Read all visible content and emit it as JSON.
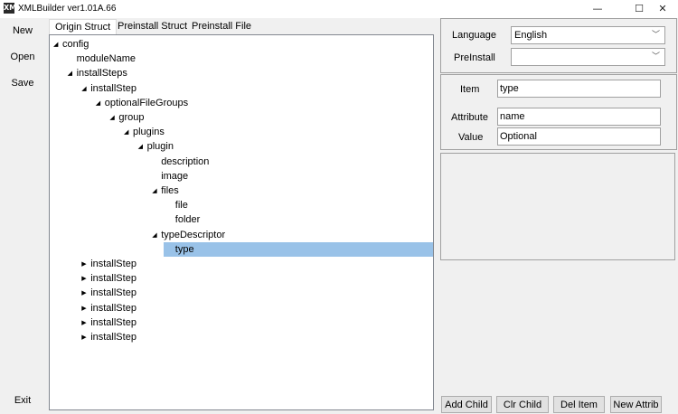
{
  "window": {
    "title": "XMLBuilder ver1.01A.66",
    "icon": "XML"
  },
  "window_controls": {
    "minimize": "—",
    "maximize": "☐",
    "close": "✕"
  },
  "toolbar": {
    "new": "New",
    "open": "Open",
    "save": "Save",
    "exit": "Exit"
  },
  "tabs": [
    "Origin Struct",
    "Preinstall Struct",
    "Preinstall File"
  ],
  "tree": {
    "expanded_glyph": "◢",
    "collapsed_glyph": "▶",
    "nodes": [
      {
        "label": "config",
        "depth": 0,
        "toggle": "expanded"
      },
      {
        "label": "moduleName",
        "depth": 1,
        "toggle": "none"
      },
      {
        "label": "installSteps",
        "depth": 1,
        "toggle": "expanded"
      },
      {
        "label": "installStep",
        "depth": 2,
        "toggle": "expanded"
      },
      {
        "label": "optionalFileGroups",
        "depth": 3,
        "toggle": "expanded"
      },
      {
        "label": "group",
        "depth": 4,
        "toggle": "expanded"
      },
      {
        "label": "plugins",
        "depth": 5,
        "toggle": "expanded"
      },
      {
        "label": "plugin",
        "depth": 6,
        "toggle": "expanded"
      },
      {
        "label": "description",
        "depth": 7,
        "toggle": "none"
      },
      {
        "label": "image",
        "depth": 7,
        "toggle": "none"
      },
      {
        "label": "files",
        "depth": 7,
        "toggle": "expanded"
      },
      {
        "label": "file",
        "depth": 8,
        "toggle": "none"
      },
      {
        "label": "folder",
        "depth": 8,
        "toggle": "none"
      },
      {
        "label": "typeDescriptor",
        "depth": 7,
        "toggle": "expanded"
      },
      {
        "label": "type",
        "depth": 8,
        "toggle": "none",
        "selected": true
      },
      {
        "label": "installStep",
        "depth": 2,
        "toggle": "collapsed"
      },
      {
        "label": "installStep",
        "depth": 2,
        "toggle": "collapsed"
      },
      {
        "label": "installStep",
        "depth": 2,
        "toggle": "collapsed"
      },
      {
        "label": "installStep",
        "depth": 2,
        "toggle": "collapsed"
      },
      {
        "label": "installStep",
        "depth": 2,
        "toggle": "collapsed"
      },
      {
        "label": "installStep",
        "depth": 2,
        "toggle": "collapsed"
      }
    ]
  },
  "settings": {
    "language_label": "Language",
    "language_value": "English",
    "preinstall_label": "PreInstall",
    "preinstall_value": "",
    "dropdown_glyph": "﹀"
  },
  "details": {
    "item_label": "Item",
    "item_value": "type",
    "attribute_label": "Attribute",
    "attribute_value": "name",
    "value_label": "Value",
    "value_value": "Optional"
  },
  "actions": {
    "add_child": "Add Child",
    "clr_child": "Clr Child",
    "del_item": "Del Item",
    "new_attrib": "New Attrib"
  },
  "colors": {
    "selection": "#99c2e8",
    "background": "#f0f0f0"
  }
}
